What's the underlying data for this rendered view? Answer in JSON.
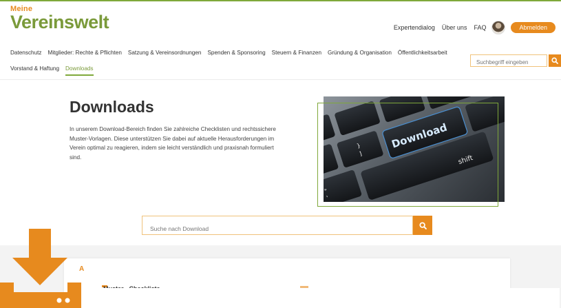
{
  "logo": {
    "small": "Meine",
    "big": "Vereinswelt"
  },
  "topnav": {
    "links": [
      "Expertendialog",
      "Über uns",
      "FAQ"
    ],
    "logout": "Abmelden"
  },
  "mainnav": {
    "row1": [
      "Datenschutz",
      "Mitglieder: Rechte & Pflichten",
      "Satzung & Vereinsordnungen",
      "Spenden & Sponsoring",
      "Steuern & Finanzen",
      "Gründung & Organisation",
      "Öffentlichkeitsarbeit"
    ],
    "row2": [
      "Vorstand & Haftung",
      "Downloads"
    ],
    "active": "Downloads"
  },
  "header_search": {
    "placeholder": "Suchbegriff eingeben"
  },
  "hero": {
    "title": "Downloads",
    "text": "In unserem Download-Bereich finden Sie zahlreiche Checklisten und rechtssichere Muster-Vorlagen. Diese unterstützen Sie dabei auf aktuelle Herausforderungen im Verein optimal zu reagieren, indem sie leicht verständlich und praxisnah formuliert sind.",
    "image_key_label": "Download",
    "image_key_shift": "shift"
  },
  "download_search": {
    "placeholder": "Suche nach Download"
  },
  "list": {
    "letter": "A",
    "first_item_partial": "Muster · Checkliste"
  },
  "colors": {
    "accent": "#e78a1e",
    "brand": "#7a9a3a"
  },
  "icons": {
    "search": "search-icon",
    "download": "download-icon"
  }
}
